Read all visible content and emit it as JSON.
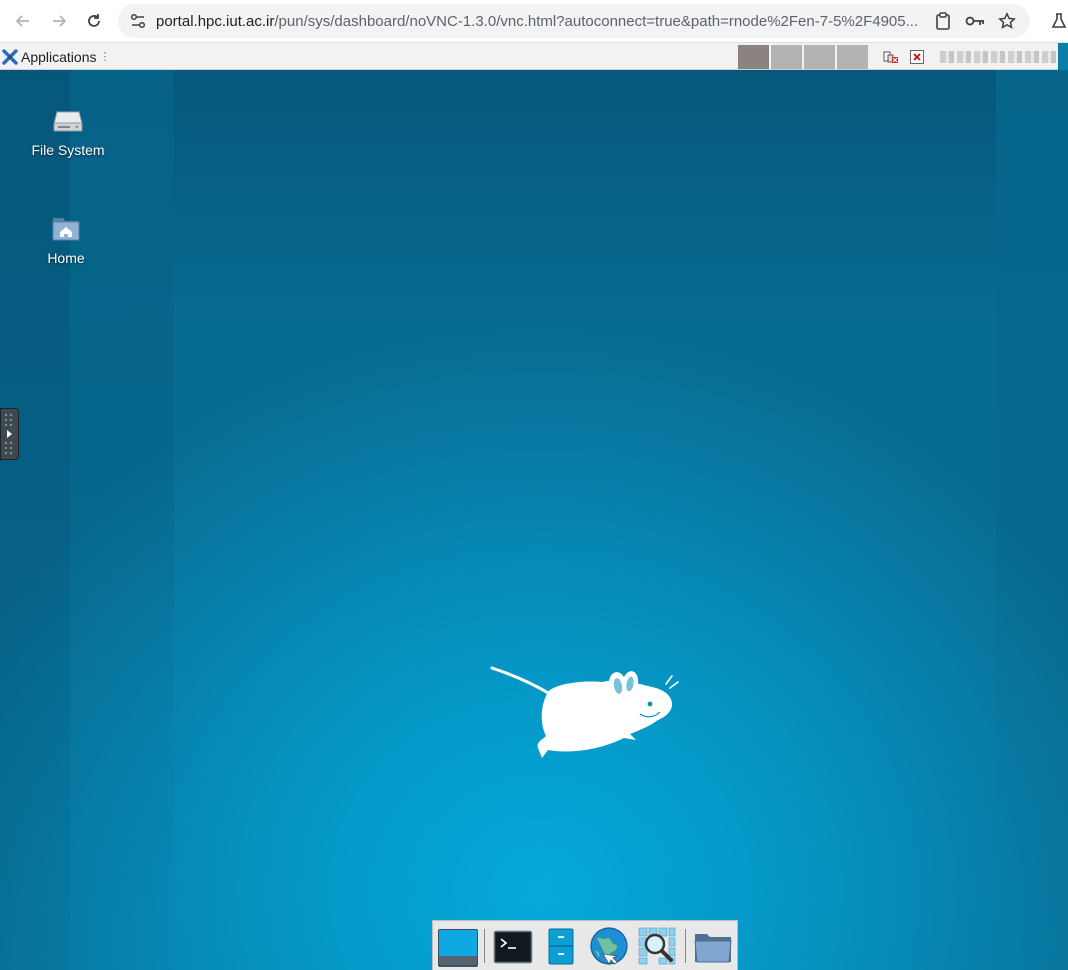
{
  "browser": {
    "url_host": "portal.hpc.iut.ac.ir",
    "url_path": "/pun/sys/dashboard/noVNC-1.3.0/vnc.html?autoconnect=true&path=rnode%2Fen-7-5%2F4905..."
  },
  "panel": {
    "applications_label": "Applications",
    "workspaces": [
      "",
      "",
      "",
      ""
    ],
    "active_workspace_index": 0
  },
  "desktop": {
    "icons": [
      {
        "label": "File System",
        "icon": "drive-harddisk-icon"
      },
      {
        "label": "Home",
        "icon": "home-folder-icon"
      }
    ]
  },
  "dock": {
    "items": [
      {
        "name": "show-desktop",
        "icon": "show-desktop-icon"
      },
      {
        "name": "terminal",
        "icon": "terminal-icon"
      },
      {
        "name": "file-manager",
        "icon": "file-cabinet-icon"
      },
      {
        "name": "web-browser",
        "icon": "globe-icon"
      },
      {
        "name": "app-finder",
        "icon": "magnifier-icon"
      },
      {
        "name": "folder",
        "icon": "folder-icon"
      }
    ]
  },
  "colors": {
    "desktop_center": "#04a9da",
    "desktop_edge": "#086c92",
    "panel_bg": "#f2f2f2",
    "active_workspace": "#8a8380",
    "inactive_workspace": "#b3b3b3"
  }
}
